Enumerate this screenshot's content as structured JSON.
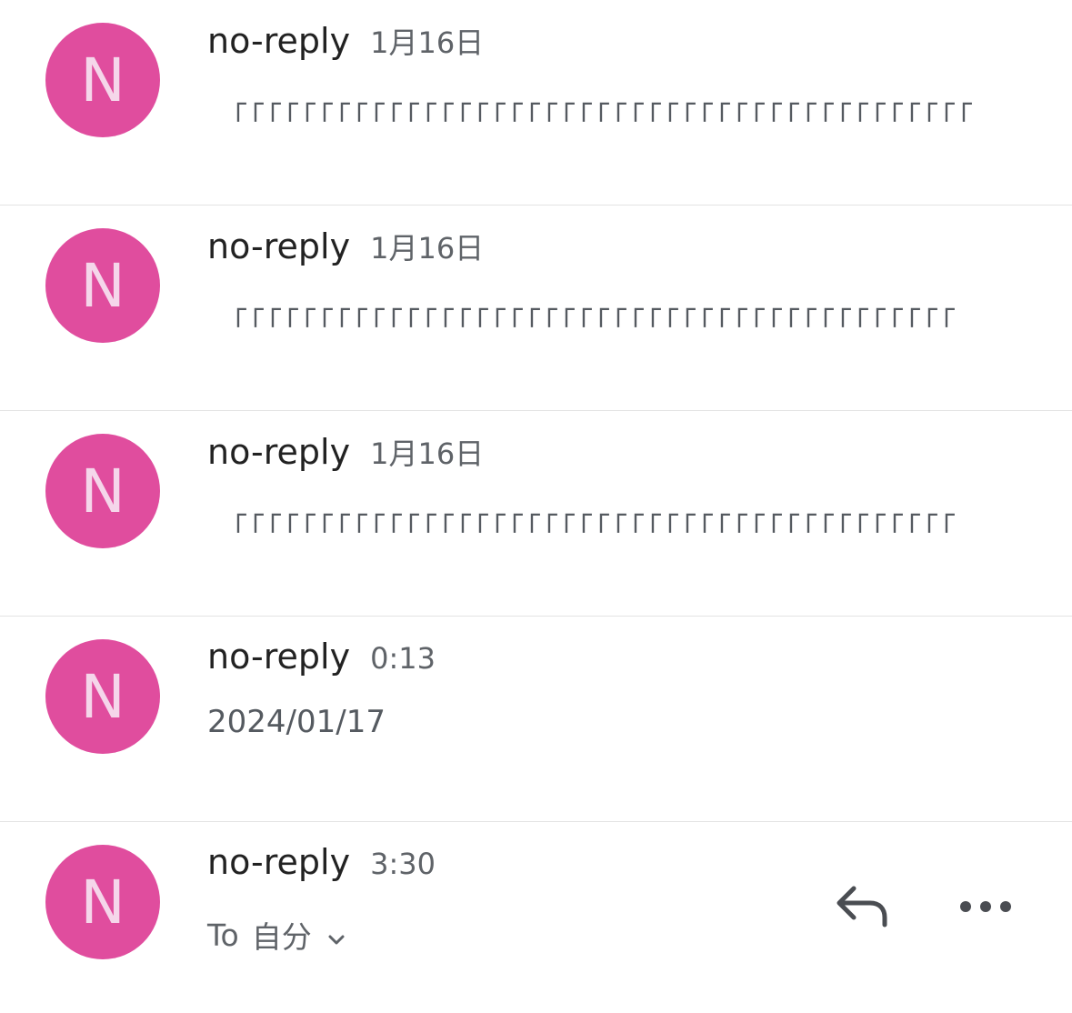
{
  "messages": [
    {
      "avatar_letter": "N",
      "sender": "no-reply",
      "time": "1月16日",
      "snippet": "「「「「「「「「「「「「「「「「「「「「「「「「「「「「「「「「「「「「「「「「「「「"
    },
    {
      "avatar_letter": "N",
      "sender": "no-reply",
      "time": "1月16日",
      "snippet": "「「「「「「「「「「「「「「「「「「「「「「「「「「「「「「「「「「「「「「「「「「"
    },
    {
      "avatar_letter": "N",
      "sender": "no-reply",
      "time": "1月16日",
      "snippet": "「「「「「「「「「「「「「「「「「「「「「「「「「「「「「「「「「「「「「「「「「「"
    },
    {
      "avatar_letter": "N",
      "sender": "no-reply",
      "time": "0:13",
      "snippet": "2024/01/17"
    }
  ],
  "open_message": {
    "avatar_letter": "N",
    "sender": "no-reply",
    "time": "3:30",
    "to_label": "To",
    "recipient": "自分",
    "reply_icon": "reply-icon",
    "more_icon": "more-horizontal-icon"
  },
  "colors": {
    "avatar_bg": "#e04d9e",
    "avatar_letter": "#f5d6ea",
    "sender_text": "#222222",
    "secondary_text": "#5f6368",
    "divider": "#e3e3e3"
  }
}
